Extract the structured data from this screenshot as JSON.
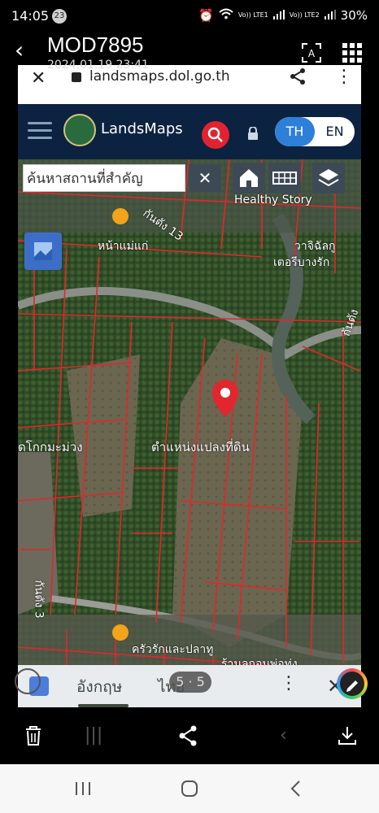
{
  "status_bar": {
    "time": "14:05",
    "notification_count": "23",
    "battery": "30%",
    "sim1": "Vo)) LTE1",
    "sim2": "Vo)) LTE2"
  },
  "gallery": {
    "title": "MOD7895",
    "date": "2024.01.19 23:41"
  },
  "browser": {
    "url": "landsmaps.dol.go.th"
  },
  "landsmaps": {
    "brand": "LandsMaps",
    "lang_th": "TH",
    "lang_en": "EN",
    "search_placeholder": "ค้นหาสถานที่สำคัญ",
    "labels": {
      "healthy_story": "Healthy Story",
      "road": "กันตัง 13",
      "waterfall": "หน้าแม่แก่",
      "school": "วาจิฉัลกู",
      "school2": "เตอรีบางรัก",
      "parcel": "ตำแหน่งแปลงที่ดิน",
      "mango": "ดโกกมะม่วง",
      "restaurant": "ครัวรักและปลาทู",
      "road_right": "กันตัง",
      "left_road": "กันตัง 3",
      "bottom_road": "ร้านลูกอนพ่อทุ่ง"
    }
  },
  "translate_bar": {
    "source": "อังกฤษ",
    "target": "ไทย"
  },
  "page_indicator": "5 · 5",
  "colors": {
    "nav_bg": "#0b2341",
    "accent_red": "#e2232f",
    "lang_active": "#2d7fd8",
    "parcel_lines": "#e3262d"
  }
}
